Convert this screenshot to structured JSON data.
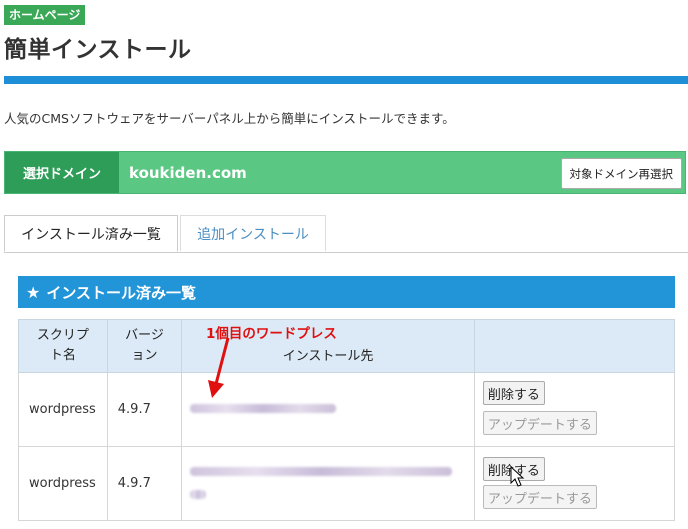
{
  "header": {
    "badge": "ホームページ",
    "title": "簡単インストール",
    "description": "人気のCMSソフトウェアをサーバーパネル上から簡単にインストールできます。"
  },
  "domain": {
    "label": "選択ドメイン",
    "value": "koukiden.com",
    "reselect_label": "対象ドメイン再選択"
  },
  "tabs": [
    {
      "label": "インストール済み一覧",
      "active": true
    },
    {
      "label": "追加インストール",
      "active": false
    }
  ],
  "panel": {
    "title": "インストール済み一覧"
  },
  "table": {
    "headers": [
      "スクリプト名",
      "バージョン",
      "インストール先",
      ""
    ],
    "rows": [
      {
        "script": "wordpress",
        "version": "4.9.7",
        "delete_label": "削除する",
        "update_label": "アップデートする"
      },
      {
        "script": "wordpress",
        "version": "4.9.7",
        "delete_label": "削除する",
        "update_label": "アップデートする"
      }
    ]
  },
  "annotation": {
    "text": "1個目のワードプレス",
    "color": "#e01010"
  },
  "colors": {
    "accent_blue": "#2294d8",
    "green": "#5ac783",
    "dark_green": "#2e9d58"
  }
}
